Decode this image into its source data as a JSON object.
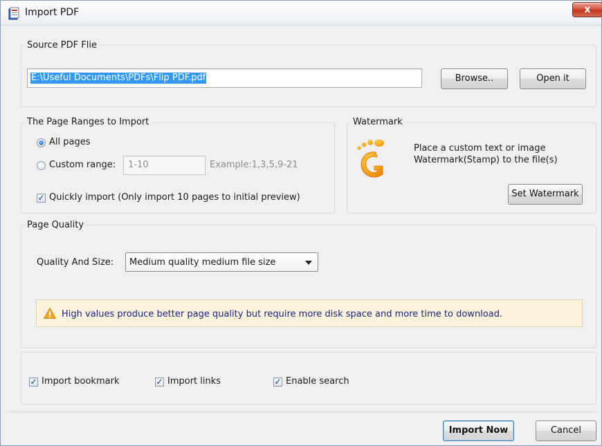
{
  "window": {
    "title": "Import PDF",
    "close_label": "x"
  },
  "source": {
    "group_label": "Source PDF Flie",
    "path_value": "E:\\Useful Documents\\PDFs\\Flip PDF.pdf",
    "browse_label": "Browse..",
    "open_label": "Open it"
  },
  "ranges": {
    "group_label": "The Page Ranges to Import",
    "all_pages_label": "All pages",
    "all_pages_selected": true,
    "custom_range_label": "Custom range:",
    "custom_range_value": "1-10",
    "example_text": "Example:1,3,5,9-21",
    "quick_import_label": "Quickly import (Only import 10 pages to  initial  preview)",
    "quick_import_checked": true
  },
  "watermark": {
    "group_label": "Watermark",
    "description_line1": "Place a custom text or image",
    "description_line2": "Watermark(Stamp) to the file(s)",
    "button_label": "Set Watermark",
    "icon": "watermark-footprint-icon"
  },
  "quality": {
    "group_label": "Page Quality",
    "label": "Quality And Size:",
    "selected": "Medium quality medium file size",
    "warning": "High values produce better page quality but require more disk space and more time to download."
  },
  "options": {
    "import_bookmark": "Import bookmark",
    "import_links": "Import links",
    "enable_search": "Enable search"
  },
  "footer": {
    "import_now": "Import Now",
    "cancel": "Cancel"
  }
}
